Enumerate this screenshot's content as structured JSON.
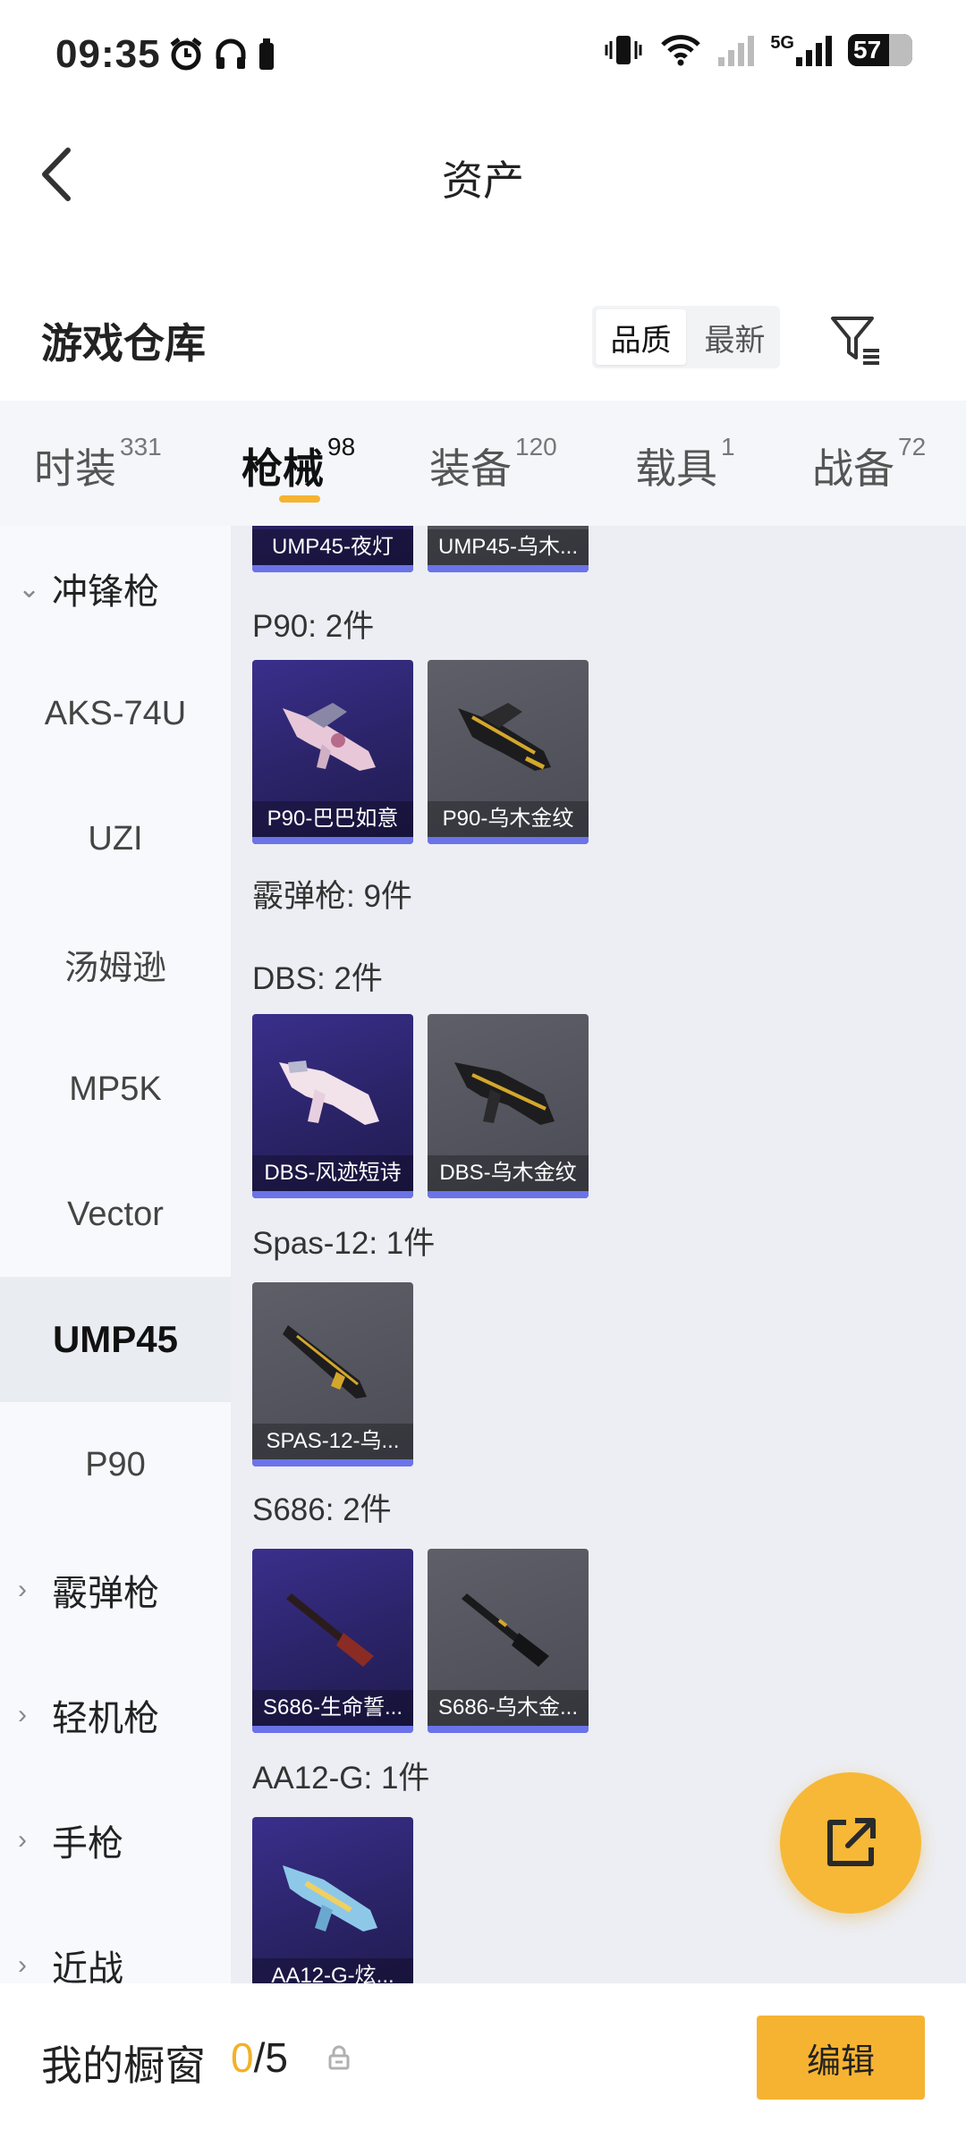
{
  "status_bar": {
    "time": "09:35",
    "network_label": "5G",
    "battery": "57"
  },
  "header": {
    "title": "资产"
  },
  "warehouse": {
    "title": "游戏仓库",
    "sort_options": [
      "品质",
      "最新"
    ],
    "active_sort": "品质"
  },
  "tabs": [
    {
      "label": "时装",
      "count": "331"
    },
    {
      "label": "枪械",
      "count": "98"
    },
    {
      "label": "装备",
      "count": "120"
    },
    {
      "label": "载具",
      "count": "1"
    },
    {
      "label": "战备",
      "count": "72"
    }
  ],
  "active_tab": "枪械",
  "sidebar": {
    "items": [
      {
        "label": "冲锋枪",
        "kind": "parent",
        "expanded": true
      },
      {
        "label": "AKS-74U",
        "kind": "child"
      },
      {
        "label": "UZI",
        "kind": "child"
      },
      {
        "label": "汤姆逊",
        "kind": "child"
      },
      {
        "label": "MP5K",
        "kind": "child"
      },
      {
        "label": "Vector",
        "kind": "child"
      },
      {
        "label": "UMP45",
        "kind": "child",
        "active": true
      },
      {
        "label": "P90",
        "kind": "child"
      },
      {
        "label": "霰弹枪",
        "kind": "parent",
        "expanded": false
      },
      {
        "label": "轻机枪",
        "kind": "parent",
        "expanded": false
      },
      {
        "label": "手枪",
        "kind": "parent",
        "expanded": false
      },
      {
        "label": "近战",
        "kind": "parent",
        "expanded": false
      }
    ]
  },
  "content": {
    "top_partial_cards": [
      "UMP45-夜灯",
      "UMP45-乌木..."
    ],
    "groups": [
      {
        "label": "P90: 2件",
        "cards": [
          {
            "name": "P90-巴巴如意",
            "style": "purple"
          },
          {
            "name": "P90-乌木金纹",
            "style": "gray"
          }
        ]
      },
      {
        "label": "霰弹枪: 9件",
        "cards": []
      },
      {
        "label": "DBS: 2件",
        "cards": [
          {
            "name": "DBS-风迹短诗",
            "style": "purple"
          },
          {
            "name": "DBS-乌木金纹",
            "style": "gray"
          }
        ]
      },
      {
        "label": "Spas-12: 1件",
        "cards": [
          {
            "name": "SPAS-12-乌...",
            "style": "gray"
          }
        ]
      },
      {
        "label": "S686: 2件",
        "cards": [
          {
            "name": "S686-生命誓...",
            "style": "purple"
          },
          {
            "name": "S686-乌木金...",
            "style": "gray"
          }
        ]
      },
      {
        "label": "AA12-G: 1件",
        "cards": [
          {
            "name": "AA12-G-炫...",
            "style": "purple"
          }
        ]
      }
    ]
  },
  "bottom_bar": {
    "showcase_label": "我的橱窗",
    "showcase_used": "0",
    "showcase_total": "/5",
    "edit_label": "编辑"
  },
  "colors": {
    "accent": "#f6b331",
    "card_purple": "#2a2366",
    "card_gray": "#4a4b54",
    "card_bar": "#6b73e8"
  }
}
